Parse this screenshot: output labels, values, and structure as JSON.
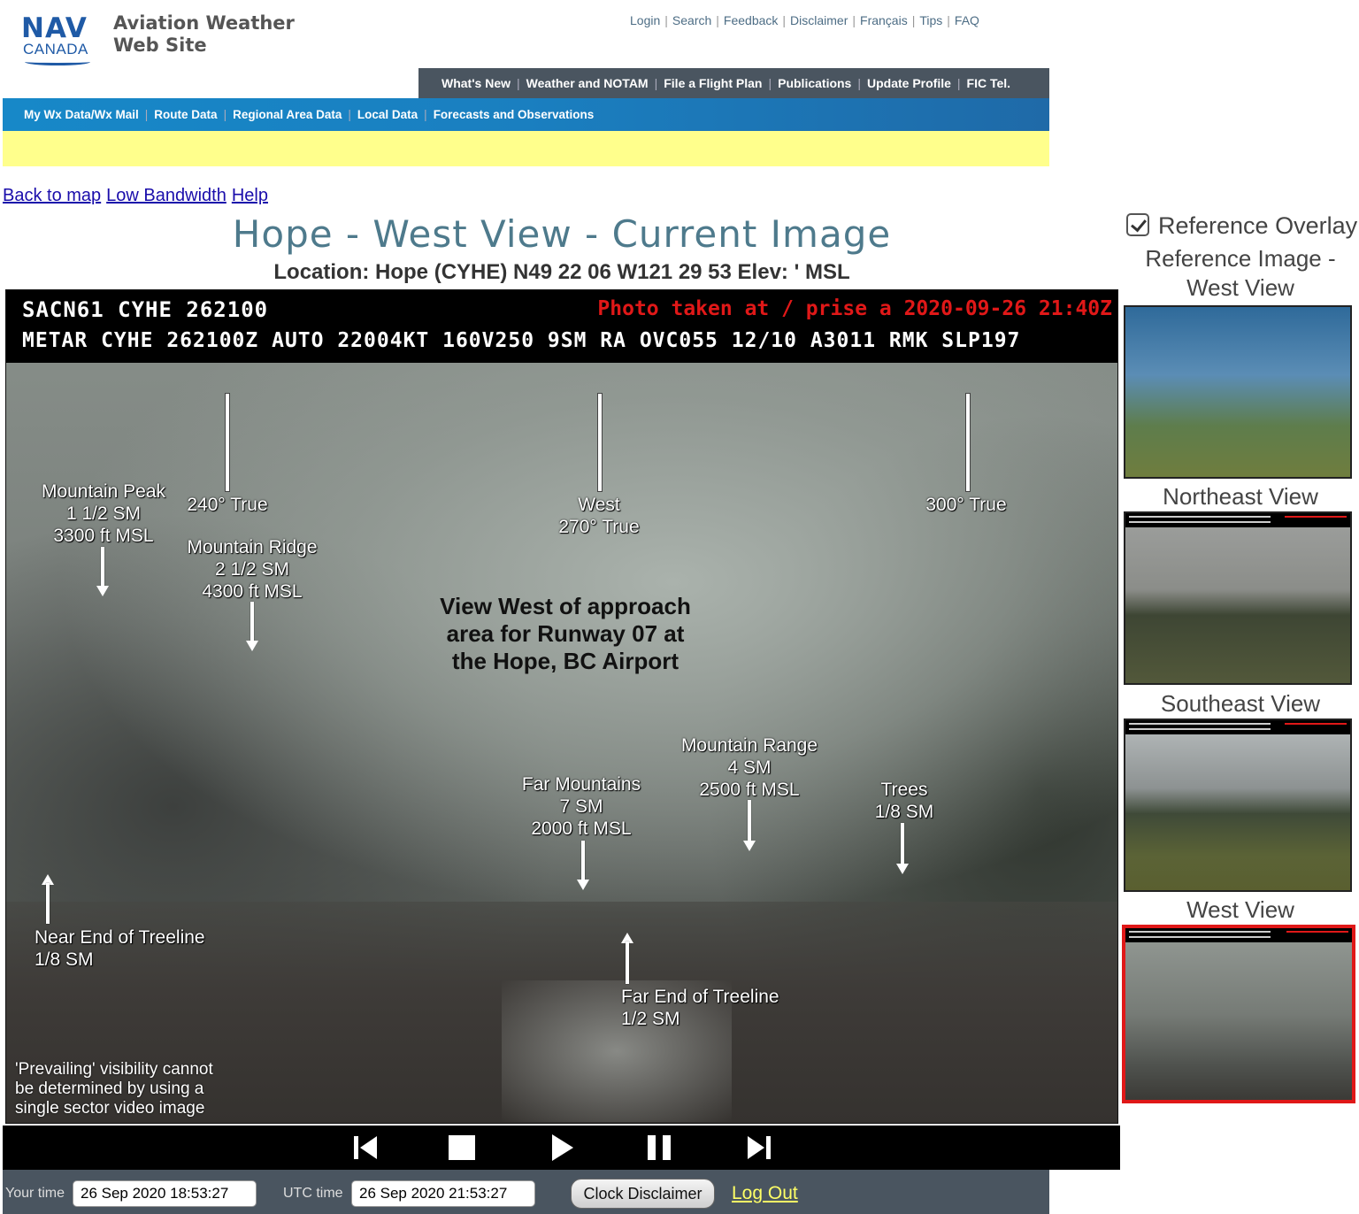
{
  "header": {
    "logo_nav": "NAV",
    "logo_canada": "CANADA",
    "site_title_line1": "Aviation Weather",
    "site_title_line2": "Web Site",
    "top_links": [
      "Login",
      "Search",
      "Feedback",
      "Disclaimer",
      "Français",
      "Tips",
      "FAQ"
    ],
    "main_nav": [
      "What's New",
      "Weather and NOTAM",
      "File a Flight Plan",
      "Publications",
      "Update Profile",
      "FIC Tel."
    ],
    "sub_nav": [
      "My Wx Data/Wx Mail",
      "Route Data",
      "Regional Area Data",
      "Local Data",
      "Forecasts and Observations"
    ]
  },
  "page_links": [
    "Back to map",
    "Low Bandwidth",
    "Help"
  ],
  "title": "Hope - West View - Current Image",
  "location": "Location: Hope (CYHE) N49 22 06 W121 29 53 Elev: ' MSL",
  "camera": {
    "header_line1": "SACN61 CYHE 262100",
    "photo_taken": "Photo taken at / prise a 2020-09-26 21:40Z",
    "header_line2": "METAR CYHE 262100Z AUTO 22004KT 160V250 9SM RA OVC055 12/10 A3011 RMK SLP197",
    "labels": {
      "mountain_peak": [
        "Mountain Peak",
        "1 1/2  SM",
        "3300 ft MSL"
      ],
      "true_240": "240° True",
      "mountain_ridge": [
        "Mountain Ridge",
        "2 1/2 SM",
        "4300 ft MSL"
      ],
      "west": [
        "West",
        "270° True"
      ],
      "true_300": "300° True",
      "view_west": [
        "View West of approach",
        "area for Runway 07 at",
        "the Hope, BC Airport"
      ],
      "far_mountains": [
        "Far Mountains",
        "7 SM",
        "2000 ft MSL"
      ],
      "mountain_range": [
        "Mountain Range",
        "4 SM",
        "2500 ft MSL"
      ],
      "trees": [
        "Trees",
        "1/8 SM"
      ],
      "near_treeline": [
        "Near End of Treeline",
        "1/8 SM"
      ],
      "far_treeline": [
        "Far End of Treeline",
        "1/2 SM"
      ],
      "prevailing_note": [
        "'Prevailing' visibility cannot",
        "be determined by using a",
        "single sector video image"
      ]
    }
  },
  "controls": [
    "first-frame",
    "stop",
    "play",
    "pause",
    "last-frame"
  ],
  "bottom_bar": {
    "your_time_label": "Your time",
    "your_time_value": "26 Sep 2020 18:53:27",
    "utc_time_label": "UTC time",
    "utc_time_value": "26 Sep 2020 21:53:27",
    "clock_disclaimer": "Clock Disclaimer",
    "log_out": "Log Out"
  },
  "sidebar": {
    "reference_overlay_label": "Reference Overlay",
    "reference_overlay_checked": true,
    "thumbnails": [
      {
        "label_line1": "Reference Image -",
        "label_line2": "West View",
        "selected": false
      },
      {
        "label_line1": "Northeast View",
        "selected": false
      },
      {
        "label_line1": "Southeast View",
        "selected": false
      },
      {
        "label_line1": "West View",
        "selected": true
      }
    ]
  },
  "colors": {
    "title": "#4e7a8c",
    "nav_dark": "#4a5560",
    "nav_blue": "#1788c8",
    "yellow_band": "#ffff8c",
    "photo_taken_red": "#e01818",
    "selected_border": "#e01818"
  }
}
